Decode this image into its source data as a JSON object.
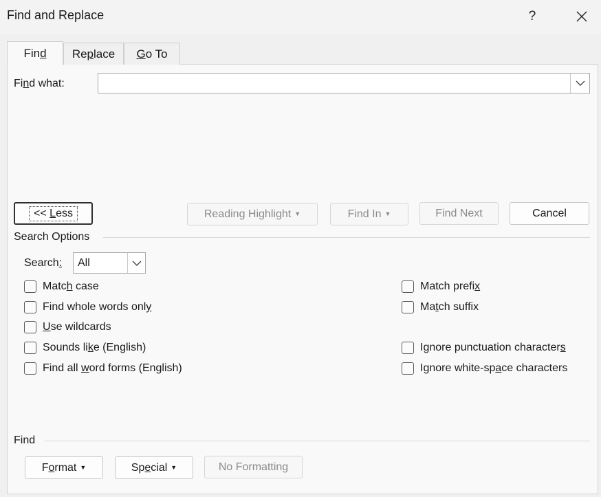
{
  "window": {
    "title": "Find and Replace",
    "help_label": "?",
    "close_label": "✕"
  },
  "tabs": [
    {
      "label": "Find",
      "active": true
    },
    {
      "label": "Replace",
      "active": false
    },
    {
      "label": "Go To",
      "active": false
    }
  ],
  "find": {
    "label": "Find what:",
    "value": "",
    "dropdown_icon": "chevron-down-icon"
  },
  "buttons": {
    "less": "<< Less",
    "reading_highlight": "Reading Highlight",
    "find_in": "Find In",
    "find_next": "Find Next",
    "cancel": "Cancel"
  },
  "search_options": {
    "section_label": "Search Options",
    "search_label": "Search:",
    "search_value": "All"
  },
  "checkboxes": {
    "left": [
      {
        "label": "Match case",
        "checked": false
      },
      {
        "label": "Find whole words only",
        "checked": false
      },
      {
        "label": "Use wildcards",
        "checked": false
      },
      {
        "label": "Sounds like (English)",
        "checked": false
      },
      {
        "label": "Find all word forms (English)",
        "checked": false
      }
    ],
    "right": [
      {
        "label": "Match prefix",
        "checked": false
      },
      {
        "label": "Match suffix",
        "checked": false
      },
      {
        "label": "Ignore punctuation characters",
        "checked": false
      },
      {
        "label": "Ignore white-space characters",
        "checked": false
      }
    ]
  },
  "find_section": {
    "label": "Find",
    "format": "Format",
    "special": "Special",
    "no_formatting": "No Formatting"
  }
}
